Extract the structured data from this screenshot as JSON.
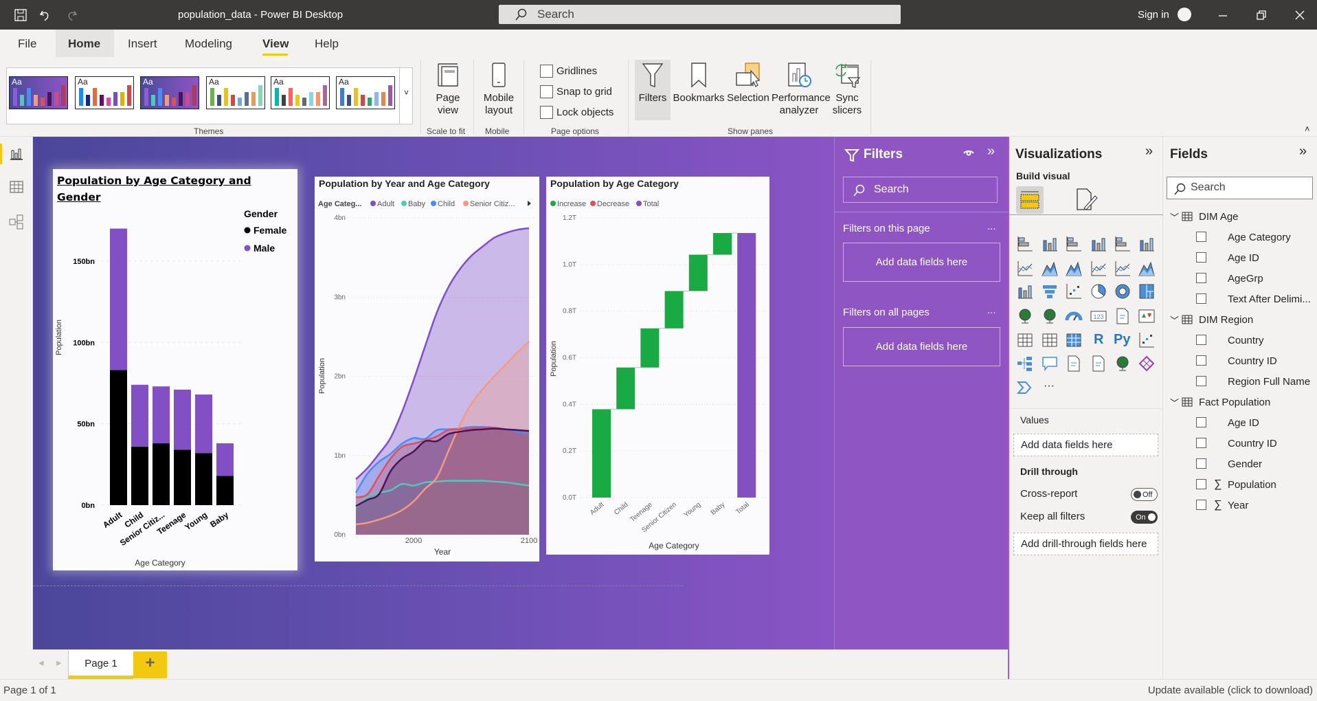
{
  "titlebar": {
    "title": "population_data - Power BI Desktop",
    "search_placeholder": "Search",
    "sign_in": "Sign in"
  },
  "menu": [
    "File",
    "Home",
    "Insert",
    "Modeling",
    "View",
    "Help"
  ],
  "menu_active": "View",
  "ribbon": {
    "themes_label": "Themes",
    "theme_thumb_text": "Aa",
    "page_view": "Page view",
    "page_view_group": "Scale to fit",
    "mobile_layout": "Mobile layout",
    "mobile_group": "Mobile",
    "checks": [
      {
        "label": "Gridlines",
        "checked": false
      },
      {
        "label": "Snap to grid",
        "checked": false
      },
      {
        "label": "Lock objects",
        "checked": false
      }
    ],
    "page_options_group": "Page options",
    "panes": [
      "Filters",
      "Bookmarks",
      "Selection",
      "Performance analyzer",
      "Sync slicers"
    ],
    "show_panes_group": "Show panes"
  },
  "themes": [
    {
      "dark": true,
      "colors": [
        "#8a5fd6",
        "#4ec9be",
        "#4a8cf2",
        "#f59a7e",
        "#e0505a",
        "#4a1558",
        "#d04a8a",
        "#b13a5a"
      ]
    },
    {
      "dark": false,
      "colors": [
        "#118dff",
        "#12239e",
        "#e66c37",
        "#6b007b",
        "#e044a7",
        "#744ec2",
        "#d9b300",
        "#d64550"
      ]
    },
    {
      "dark": true,
      "colors": [
        "#8a5fd6",
        "#4ec9be",
        "#4a8cf2",
        "#f59a7e",
        "#e0505a",
        "#4a1558",
        "#d04a8a",
        "#b13a5a"
      ]
    },
    {
      "dark": false,
      "colors": [
        "#6ab04c",
        "#3c4f7a",
        "#e8c21e",
        "#d64545",
        "#6fa8dc",
        "#5a6f8e",
        "#e89a5a",
        "#86d6b8"
      ]
    },
    {
      "dark": false,
      "colors": [
        "#01b8aa",
        "#374649",
        "#fd625e",
        "#f2c80f",
        "#5f6b6d",
        "#8ad4eb",
        "#fe9666",
        "#a66999"
      ]
    },
    {
      "dark": false,
      "colors": [
        "#3a7dd8",
        "#3c4f7a",
        "#e8c21e",
        "#d64545",
        "#2ea36b",
        "#8fb8e8",
        "#e0874a",
        "#9b58a6"
      ]
    }
  ],
  "colors": {
    "canvas_left": "#4a479a",
    "canvas_right": "#8a54c6",
    "filters_pane": "#8f55c2",
    "accent": "#f2c811"
  },
  "filters": {
    "title": "Filters",
    "search": "Search",
    "this_page": "Filters on this page",
    "all_pages": "Filters on all pages",
    "add_fields": "Add data fields here",
    "more": "..."
  },
  "visualizations": {
    "title": "Visualizations",
    "build_visual": "Build visual",
    "icons": [
      "stacked-bar",
      "stacked-column",
      "clustered-bar",
      "clustered-column",
      "100-stacked-bar",
      "100-stacked-column",
      "line",
      "area",
      "stacked-area",
      "line-stacked-column",
      "line-clustered-column",
      "ribbon",
      "waterfall",
      "funnel",
      "scatter",
      "pie",
      "donut",
      "treemap",
      "map",
      "filled-map",
      "gauge",
      "card",
      "multi-row-card",
      "kpi",
      "slicer",
      "table",
      "matrix",
      "r-visual",
      "python-visual",
      "key-influencers",
      "decomposition-tree",
      "qa",
      "smart-narrative",
      "paginated-report",
      "azure-map",
      "power-apps",
      "power-automate",
      "more"
    ],
    "r_glyph": "R",
    "py_glyph": "Py",
    "more_glyph": "···",
    "values": "Values",
    "add_fields": "Add data fields here",
    "drill_through": "Drill through",
    "cross_report": "Cross-report",
    "cross_report_state": "Off",
    "keep_filters": "Keep all filters",
    "keep_filters_state": "On",
    "add_drill": "Add drill-through fields here"
  },
  "fields": {
    "title": "Fields",
    "search": "Search",
    "tables": [
      {
        "name": "DIM Age",
        "fields": [
          {
            "name": "Age Category",
            "sum": false
          },
          {
            "name": "Age ID",
            "sum": false
          },
          {
            "name": "AgeGrp",
            "sum": false
          },
          {
            "name": "Text After Delimi...",
            "sum": false
          }
        ]
      },
      {
        "name": "DIM Region",
        "fields": [
          {
            "name": "Country",
            "sum": false
          },
          {
            "name": "Country ID",
            "sum": false
          },
          {
            "name": "Region Full Name",
            "sum": false
          }
        ]
      },
      {
        "name": "Fact Population",
        "fields": [
          {
            "name": "Age ID",
            "sum": false
          },
          {
            "name": "Country ID",
            "sum": false
          },
          {
            "name": "Gender",
            "sum": false
          },
          {
            "name": "Population",
            "sum": true
          },
          {
            "name": "Year",
            "sum": true
          }
        ]
      }
    ]
  },
  "pages": {
    "tabs": [
      "Page 1"
    ],
    "add": "+"
  },
  "status": {
    "page": "Page 1 of 1",
    "update": "Update available (click to download)"
  },
  "chart_data": [
    {
      "type": "bar",
      "stacked": true,
      "title": "Population by Age Category and Gender",
      "xlabel": "Age Category",
      "ylabel": "Population",
      "categories": [
        "Adult",
        "Child",
        "Senior Citiz...",
        "Teenage",
        "Young",
        "Baby"
      ],
      "legend_title": "Gender",
      "legend_position": "top-right",
      "series": [
        {
          "name": "Female",
          "color": "#000000",
          "values": [
            83,
            36,
            38,
            34,
            32,
            18
          ]
        },
        {
          "name": "Male",
          "color": "#8350c4",
          "values": [
            87,
            38,
            35,
            37,
            36,
            20
          ]
        }
      ],
      "yticks": [
        "0bn",
        "50bn",
        "100bn",
        "150bn"
      ],
      "ytick_values": [
        0,
        50,
        100,
        150
      ],
      "ylim": [
        0,
        175
      ],
      "unit": "bn",
      "grid": true
    },
    {
      "type": "area",
      "title": "Population by Year and Age Category",
      "xlabel": "Year",
      "ylabel": "Population",
      "legend_title": "Age Categ...",
      "legend_position": "top",
      "legend": [
        "Adult",
        "Baby",
        "Child",
        "Senior Citiz..."
      ],
      "x": [
        1950,
        1960,
        1970,
        1980,
        1990,
        2000,
        2010,
        2020,
        2030,
        2040,
        2050,
        2060,
        2070,
        2080,
        2090,
        2100
      ],
      "xticks": [
        "2000",
        "2100"
      ],
      "xtick_values": [
        2000,
        2100
      ],
      "yticks": [
        "0bn",
        "1bn",
        "2bn",
        "3bn",
        "4bn"
      ],
      "ytick_values": [
        0,
        1,
        2,
        3,
        4
      ],
      "ylim": [
        0,
        4
      ],
      "xlim": [
        1950,
        2100
      ],
      "unit": "bn",
      "grid": true,
      "series": [
        {
          "name": "Adult",
          "color": "#7e4fc8",
          "values": [
            0.7,
            0.84,
            1.02,
            1.22,
            1.55,
            1.95,
            2.38,
            2.8,
            3.12,
            3.35,
            3.52,
            3.64,
            3.75,
            3.81,
            3.85,
            3.87
          ]
        },
        {
          "name": "Baby",
          "color": "#4ec9be",
          "values": [
            0.34,
            0.48,
            0.53,
            0.56,
            0.64,
            0.62,
            0.66,
            0.67,
            0.68,
            0.68,
            0.68,
            0.68,
            0.67,
            0.66,
            0.64,
            0.62
          ]
        },
        {
          "name": "Child",
          "color": "#4a8cf2",
          "values": [
            0.53,
            0.77,
            0.92,
            1.02,
            1.15,
            1.22,
            1.21,
            1.32,
            1.33,
            1.34,
            1.36,
            1.36,
            1.35,
            1.33,
            1.3,
            1.27
          ]
        },
        {
          "name": "Senior Citiz...",
          "color": "#f59a7e",
          "values": [
            0.13,
            0.15,
            0.19,
            0.24,
            0.31,
            0.42,
            0.58,
            0.72,
            1.05,
            1.38,
            1.65,
            1.84,
            2.0,
            2.15,
            2.3,
            2.44
          ]
        },
        {
          "color": "#e0505a",
          "values": [
            0.47,
            0.51,
            0.74,
            0.96,
            1.11,
            1.15,
            1.19,
            1.24,
            1.32,
            1.33,
            1.34,
            1.35,
            1.35,
            1.33,
            1.32,
            1.3
          ]
        },
        {
          "color": "#4a1558",
          "values": [
            0.36,
            0.44,
            0.51,
            0.8,
            0.96,
            1.05,
            1.18,
            1.18,
            1.27,
            1.3,
            1.32,
            1.33,
            1.34,
            1.33,
            1.32,
            1.31
          ]
        }
      ]
    },
    {
      "type": "waterfall",
      "title": "Population by Age Category",
      "xlabel": "Age Category",
      "ylabel": "Population",
      "legend": [
        {
          "name": "Increase",
          "color": "#1aaa44"
        },
        {
          "name": "Decrease",
          "color": "#e0505a"
        },
        {
          "name": "Total",
          "color": "#8350c4"
        }
      ],
      "legend_position": "top",
      "categories": [
        "Adult",
        "Child",
        "Teenage",
        "Senior Citizen",
        "Young",
        "Baby",
        "Total"
      ],
      "values": [
        0.379,
        0.179,
        0.168,
        0.16,
        0.156,
        0.093,
        1.135
      ],
      "yticks": [
        "0.0T",
        "0.2T",
        "0.4T",
        "0.6T",
        "0.8T",
        "1.0T",
        "1.2T"
      ],
      "ytick_values": [
        0,
        0.2,
        0.4,
        0.6,
        0.8,
        1.0,
        1.2
      ],
      "ylim": [
        0,
        1.2
      ],
      "unit": "T",
      "grid": true
    }
  ]
}
